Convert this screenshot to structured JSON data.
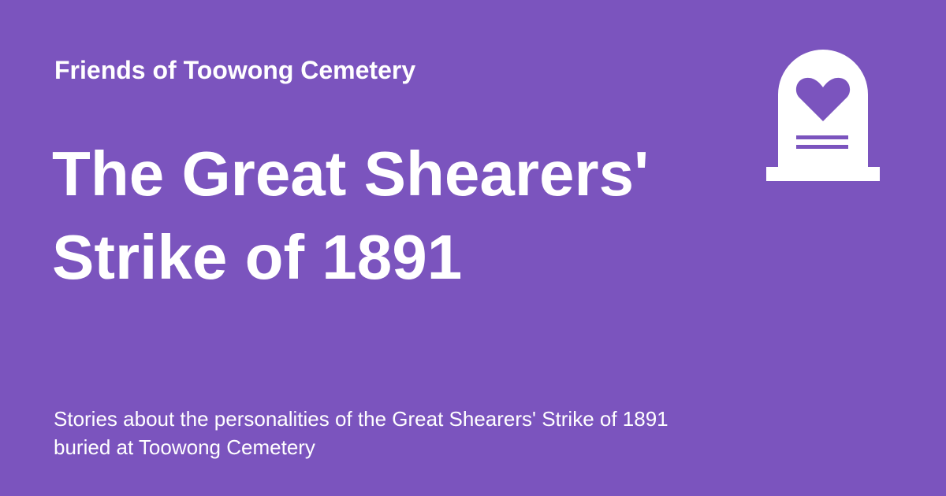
{
  "site": {
    "name": "Friends of Toowong Cemetery"
  },
  "card": {
    "title": "The Great Shearers' Strike of 1891",
    "subtitle": "Stories about the personalities of the Great Shearers' Strike of 1891 buried at Toowong Cemetery"
  },
  "logo": {
    "icon": "headstone-heart-icon"
  },
  "colors": {
    "background": "#7b54be",
    "text": "#ffffff"
  }
}
